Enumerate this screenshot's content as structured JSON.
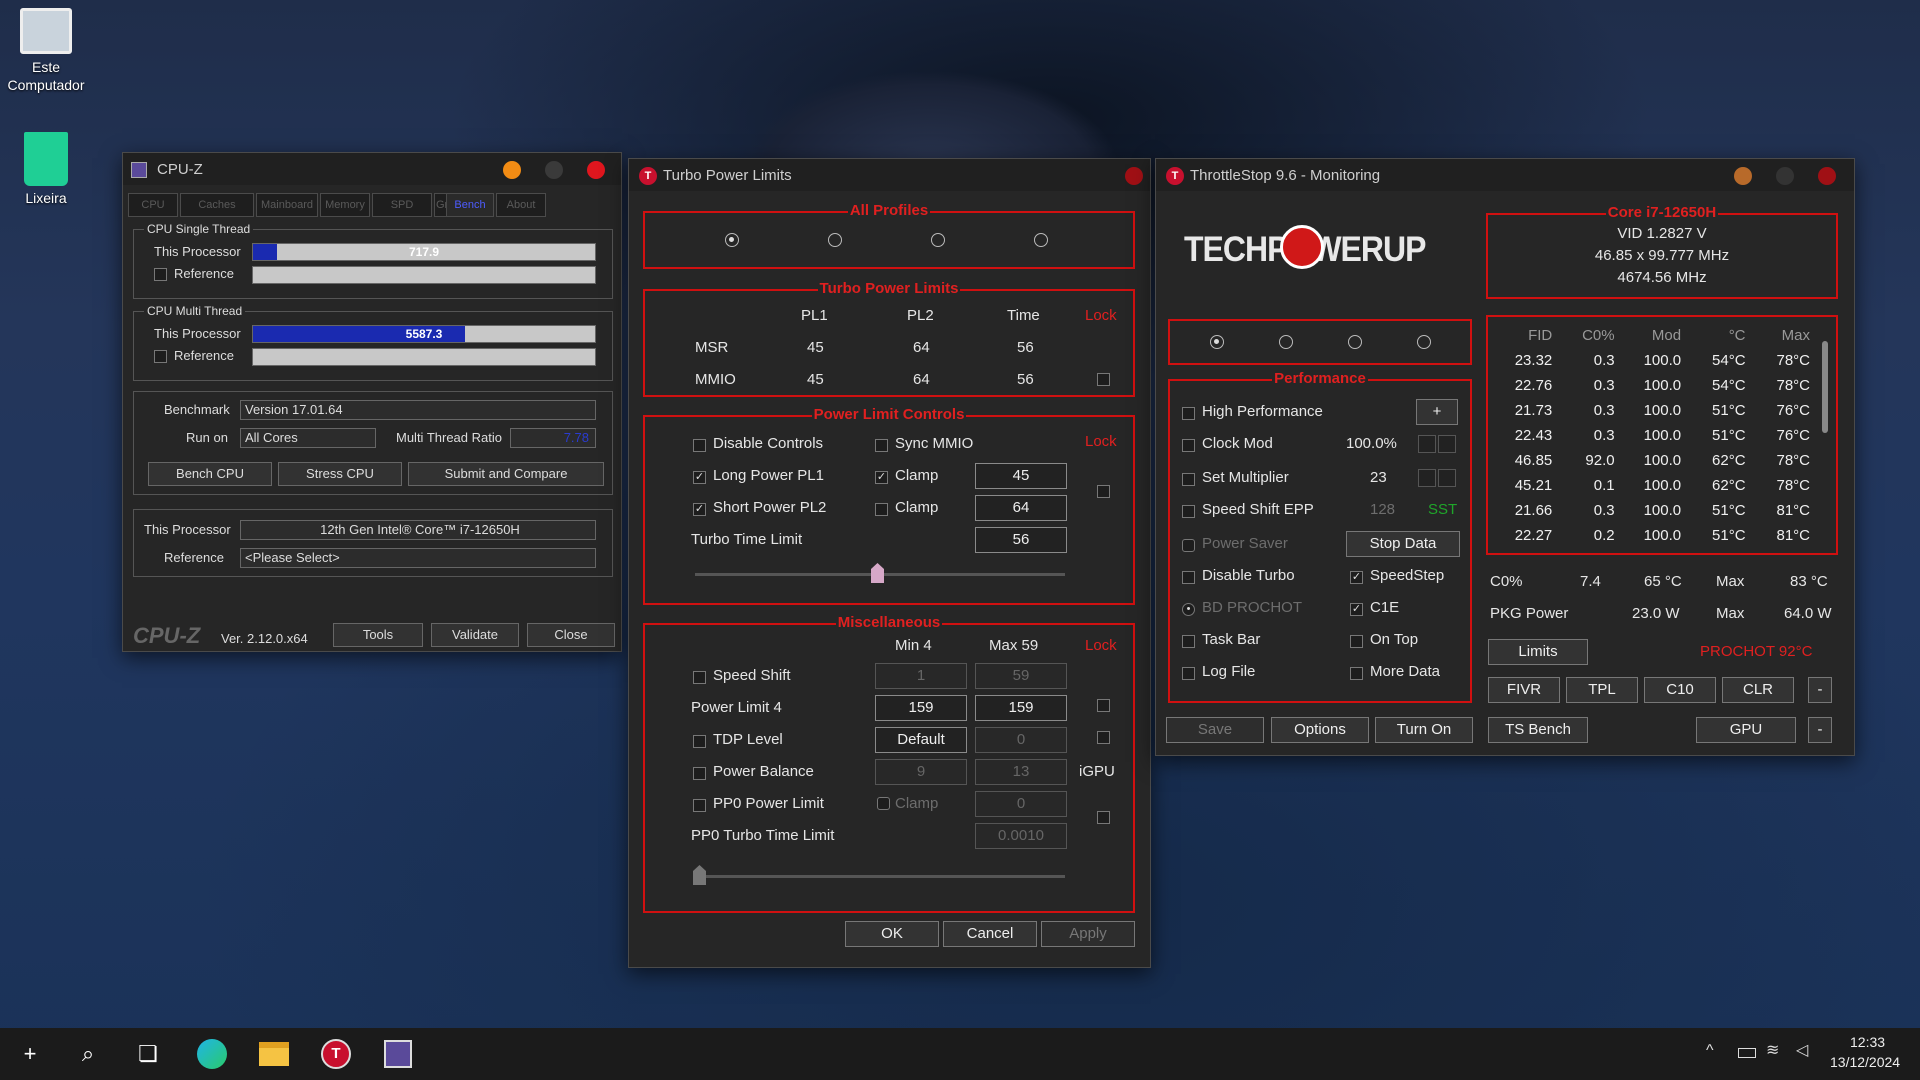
{
  "desktop": {
    "icons": [
      {
        "label": "Este\nComputador"
      },
      {
        "label": "Lixeira"
      }
    ]
  },
  "cpuz": {
    "title": "CPU-Z",
    "tabs": [
      "CPU",
      "Caches",
      "Mainboard",
      "Memory",
      "SPD",
      "Graphics",
      "Bench",
      "About"
    ],
    "single_thread": {
      "title": "CPU Single Thread",
      "this_label": "This Processor",
      "this_value": "717.9",
      "this_fill": 0.07,
      "ref_label": "Reference"
    },
    "multi_thread": {
      "title": "CPU Multi Thread",
      "this_label": "This Processor",
      "this_value": "5587.3",
      "this_fill": 0.62,
      "ref_label": "Reference"
    },
    "benchmark_label": "Benchmark",
    "benchmark_value": "Version 17.01.64",
    "run_on_label": "Run on",
    "run_on_value": "All Cores",
    "ratio_label": "Multi Thread Ratio",
    "ratio_value": "7.78",
    "buttons": [
      "Bench CPU",
      "Stress CPU",
      "Submit and Compare"
    ],
    "proc_label": "This Processor",
    "proc_value": "12th Gen Intel® Core™ i7-12650H",
    "ref_label": "Reference",
    "ref_value": "<Please Select>",
    "footer_logo": "CPU-Z",
    "version": "Ver. 2.12.0.x64",
    "tools": "Tools",
    "validate": "Validate",
    "close": "Close"
  },
  "tpl": {
    "title": "Turbo Power Limits",
    "all_profiles": "All Profiles",
    "turbo_power_limits": "Turbo Power Limits",
    "cols": {
      "pl1": "PL1",
      "pl2": "PL2",
      "time": "Time",
      "lock": "Lock"
    },
    "msr": {
      "label": "MSR",
      "pl1": "45",
      "pl2": "64",
      "time": "56"
    },
    "mmio": {
      "label": "MMIO",
      "pl1": "45",
      "pl2": "64",
      "time": "56"
    },
    "plc_title": "Power Limit Controls",
    "disable_controls": "Disable Controls",
    "sync_mmio": "Sync MMIO",
    "lock": "Lock",
    "long_power": "Long Power PL1",
    "short_power": "Short Power PL2",
    "clamp": "Clamp",
    "pl1_value": "45",
    "pl2_value": "64",
    "turbo_time_limit": "Turbo Time Limit",
    "turbo_time_value": "56",
    "misc_title": "Miscellaneous",
    "min_label": "Min  4",
    "max_label": "Max  59",
    "speed_shift": "Speed Shift",
    "speed_min": "1",
    "speed_max": "59",
    "power_limit4": "Power Limit 4",
    "pl4_min": "159",
    "pl4_max": "159",
    "tdp_level": "TDP Level",
    "tdp_value": "Default",
    "tdp_max": "0",
    "power_balance": "Power Balance",
    "pb_min": "9",
    "pb_max": "13",
    "igpu": "iGPU",
    "pp0_limit": "PP0 Power Limit",
    "pp0_clamp": "Clamp",
    "pp0_value": "0",
    "pp0_time": "PP0 Turbo Time Limit",
    "pp0_time_value": "0.0010",
    "ok": "OK",
    "cancel": "Cancel",
    "apply": "Apply"
  },
  "ts": {
    "title": "ThrottleStop 9.6 - Monitoring",
    "logo": "TECHPOWERUP",
    "cpu_title": "Core i7-12650H",
    "vid": "VID  1.2827 V",
    "freq": "46.85 x 99.777 MHz",
    "mhz": "4674.56 MHz",
    "table_headers": [
      "FID",
      "C0%",
      "Mod",
      "°C",
      "Max"
    ],
    "rows": [
      [
        "23.32",
        "0.3",
        "100.0",
        "54°C",
        "78°C"
      ],
      [
        "22.76",
        "0.3",
        "100.0",
        "54°C",
        "78°C"
      ],
      [
        "21.73",
        "0.3",
        "100.0",
        "51°C",
        "76°C"
      ],
      [
        "22.43",
        "0.3",
        "100.0",
        "51°C",
        "76°C"
      ],
      [
        "46.85",
        "92.0",
        "100.0",
        "62°C",
        "78°C"
      ],
      [
        "45.21",
        "0.1",
        "100.0",
        "62°C",
        "78°C"
      ],
      [
        "21.66",
        "0.3",
        "100.0",
        "51°C",
        "81°C"
      ],
      [
        "22.27",
        "0.2",
        "100.0",
        "51°C",
        "81°C"
      ]
    ],
    "perf_title": "Performance",
    "high_perf": "High Performance",
    "plus": "+",
    "clock_mod": "Clock Mod",
    "clock_mod_value": "100.0%",
    "set_mult": "Set Multiplier",
    "set_mult_value": "23",
    "ss_epp": "Speed Shift EPP",
    "ss_epp_value": "128",
    "sst": "SST",
    "power_saver": "Power Saver",
    "stop_data": "Stop Data",
    "disable_turbo": "Disable Turbo",
    "speedstep": "SpeedStep",
    "bd_prochot": "BD PROCHOT",
    "c1e": "C1E",
    "task_bar": "Task Bar",
    "on_top": "On Top",
    "log_file": "Log File",
    "more_data": "More Data",
    "c0_label": "C0%",
    "c0_value": "7.4",
    "temp_value": "65 °C",
    "max_label": "Max",
    "max_temp": "83 °C",
    "pkg_label": "PKG Power",
    "pkg_value": "23.0 W",
    "pkg_max": "64.0 W",
    "limits": "Limits",
    "prochot": "PROCHOT 92°C",
    "fivr": "FIVR",
    "tpl": "TPL",
    "c10": "C10",
    "clr": "CLR",
    "minus": "-",
    "save": "Save",
    "options": "Options",
    "turn_on": "Turn On",
    "ts_bench": "TS Bench",
    "gpu": "GPU"
  },
  "taskbar": {
    "time": "12:33",
    "date": "13/12/2024"
  }
}
